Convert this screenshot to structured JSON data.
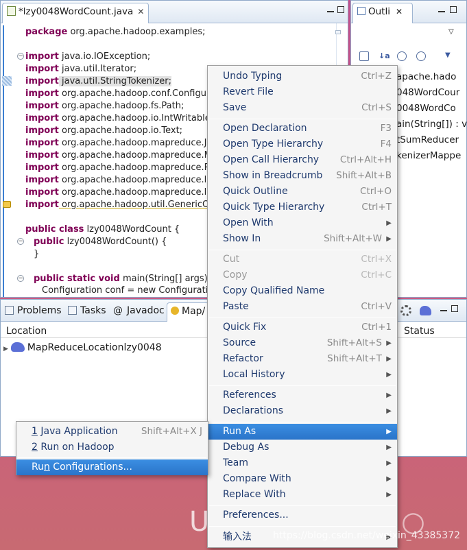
{
  "editor": {
    "tab_title": "*lzy0048WordCount.java",
    "lines": [
      {
        "kw": "package",
        "text": " org.apache.hadoop.examples;"
      },
      {
        "kw": "import",
        "text": " java.io.IOException;"
      },
      {
        "kw": "import",
        "text": " java.util.Iterator;"
      },
      {
        "kw": "import",
        "text": " java.util.StringTokenizer;"
      },
      {
        "kw": "import",
        "text": " org.apache.hadoop.conf.Configurati"
      },
      {
        "kw": "import",
        "text": " org.apache.hadoop.fs.Path;"
      },
      {
        "kw": "import",
        "text": " org.apache.hadoop.io.IntWritable;"
      },
      {
        "kw": "import",
        "text": " org.apache.hadoop.io.Text;"
      },
      {
        "kw": "import",
        "text": " org.apache.hadoop.mapreduce.Job;"
      },
      {
        "kw": "import",
        "text": " org.apache.hadoop.mapreduce.Map"
      },
      {
        "kw": "import",
        "text": " org.apache.hadoop.mapreduce.Red"
      },
      {
        "kw": "import",
        "text": " org.apache.hadoop.mapreduce.lib.i"
      },
      {
        "kw": "import",
        "text": " org.apache.hadoop.mapreduce.lib.o"
      },
      {
        "kw": "import",
        "text": " org.apache.hadoop.util.GenericOpti"
      },
      {
        "kw": "public class",
        "text": " lzy0048WordCount {"
      },
      {
        "kw": "public",
        "text": " lzy0048WordCount() {"
      },
      {
        "kw": "",
        "text": "}"
      },
      {
        "kw": "public static void",
        "text": " main(String[] args) thro"
      },
      {
        "kw": "",
        "text": "Configuration conf = new Configuration("
      }
    ]
  },
  "outline": {
    "tab_title": "Outli",
    "items": [
      "apache.hado",
      "048WordCour",
      "0048WordCo",
      "ain(String[]) : v",
      "tSumReducer",
      "kenizerMappe"
    ]
  },
  "bottom": {
    "tabs": [
      "Problems",
      "Tasks",
      "Javadoc",
      "Map/"
    ],
    "col_location": "Location",
    "col_status": "Status",
    "row": "MapReduceLocationlzy0048"
  },
  "menu": {
    "items": [
      {
        "label": "Undo Typing",
        "acc": "Ctrl+Z"
      },
      {
        "label": "Revert File",
        "acc": ""
      },
      {
        "label": "Save",
        "acc": "Ctrl+S"
      },
      {
        "label": "Open Declaration",
        "acc": "F3"
      },
      {
        "label": "Open Type Hierarchy",
        "acc": "F4"
      },
      {
        "label": "Open Call Hierarchy",
        "acc": "Ctrl+Alt+H"
      },
      {
        "label": "Show in Breadcrumb",
        "acc": "Shift+Alt+B"
      },
      {
        "label": "Quick Outline",
        "acc": "Ctrl+O"
      },
      {
        "label": "Quick Type Hierarchy",
        "acc": "Ctrl+T"
      },
      {
        "label": "Open With",
        "acc": ""
      },
      {
        "label": "Show In",
        "acc": "Shift+Alt+W"
      },
      {
        "label": "Cut",
        "acc": "Ctrl+X"
      },
      {
        "label": "Copy",
        "acc": "Ctrl+C"
      },
      {
        "label": "Copy Qualified Name",
        "acc": ""
      },
      {
        "label": "Paste",
        "acc": "Ctrl+V"
      },
      {
        "label": "Quick Fix",
        "acc": "Ctrl+1"
      },
      {
        "label": "Source",
        "acc": "Shift+Alt+S"
      },
      {
        "label": "Refactor",
        "acc": "Shift+Alt+T"
      },
      {
        "label": "Local History",
        "acc": ""
      },
      {
        "label": "References",
        "acc": ""
      },
      {
        "label": "Declarations",
        "acc": ""
      },
      {
        "label": "Run As",
        "acc": ""
      },
      {
        "label": "Debug As",
        "acc": ""
      },
      {
        "label": "Team",
        "acc": ""
      },
      {
        "label": "Compare With",
        "acc": ""
      },
      {
        "label": "Replace With",
        "acc": ""
      },
      {
        "label": "Preferences...",
        "acc": ""
      },
      {
        "label": "输入法",
        "acc": ""
      }
    ]
  },
  "submenu": {
    "items": [
      {
        "mnemonic": "1",
        "label": " Java Application",
        "acc": "Shift+Alt+X J"
      },
      {
        "mnemonic": "2",
        "label": " Run on Hadoop",
        "acc": ""
      },
      {
        "pre": "Ru",
        "mnemonic": "n",
        "label": " Configurations...",
        "acc": ""
      }
    ]
  },
  "desktop": {
    "big_letter": "U",
    "watermark": "https://blog.csdn.net/weixin_43385372"
  }
}
